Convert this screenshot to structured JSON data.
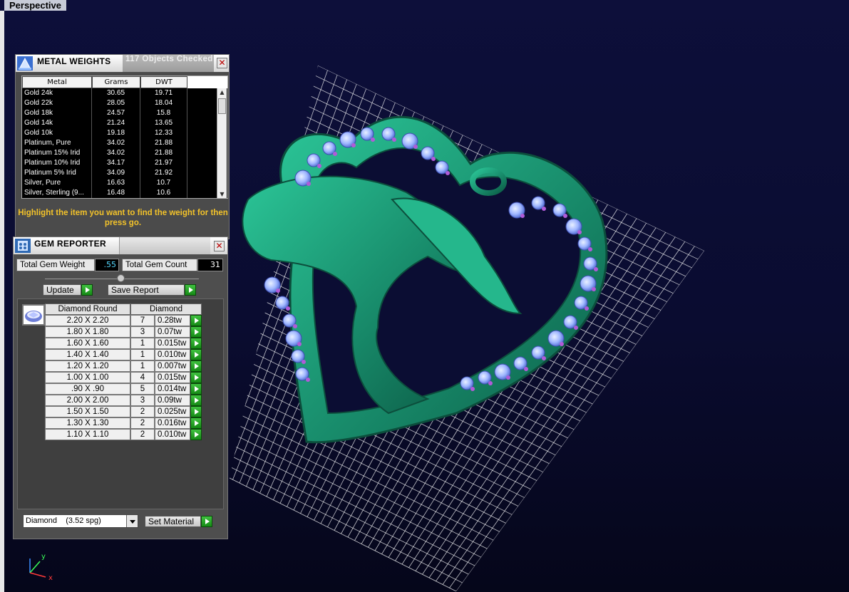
{
  "viewport": {
    "label": "Perspective"
  },
  "metal_weights": {
    "title": "METAL WEIGHTS",
    "objects_checked": "117 Objects Checked",
    "close": "✕",
    "columns": [
      "Metal",
      "Grams",
      "DWT"
    ],
    "rows": [
      [
        "Gold 24k",
        "30.65",
        "19.71"
      ],
      [
        "Gold 22k",
        "28.05",
        "18.04"
      ],
      [
        "Gold 18k",
        "24.57",
        "15.8"
      ],
      [
        "Gold 14k",
        "21.24",
        "13.65"
      ],
      [
        "Gold 10k",
        "19.18",
        "12.33"
      ],
      [
        "Platinum, Pure",
        "34.02",
        "21.88"
      ],
      [
        "Platinum 15% Irid",
        "34.02",
        "21.88"
      ],
      [
        "Platinum 10% Irid",
        "34.17",
        "21.97"
      ],
      [
        "Platinum 5% Irid",
        "34.09",
        "21.92"
      ],
      [
        "Silver, Pure",
        "16.63",
        "10.7"
      ],
      [
        "Silver, Sterling (9...",
        "16.48",
        "10.6"
      ]
    ],
    "hint": "Highlight the item you want to find the weight for then press go."
  },
  "gem_reporter": {
    "title": "GEM REPORTER",
    "close": "✕",
    "total_weight_label": "Total Gem Weight",
    "total_weight_value": ".55",
    "total_count_label": "Total Gem Count",
    "total_count_value": "31",
    "update_label": "Update",
    "save_report_label": "Save Report",
    "table_headers": [
      "Diamond Round",
      "Diamond"
    ],
    "gems": [
      [
        "2.20 X 2.20",
        "7",
        "0.28tw"
      ],
      [
        "1.80 X 1.80",
        "3",
        "0.07tw"
      ],
      [
        "1.60 X 1.60",
        "1",
        "0.015tw"
      ],
      [
        "1.40 X 1.40",
        "1",
        "0.010tw"
      ],
      [
        "1.20 X 1.20",
        "1",
        "0.007tw"
      ],
      [
        "1.00 X 1.00",
        "4",
        "0.015tw"
      ],
      [
        ".90 X .90",
        "5",
        "0.014tw"
      ],
      [
        "2.00 X 2.00",
        "3",
        "0.09tw"
      ],
      [
        "1.50 X 1.50",
        "2",
        "0.025tw"
      ],
      [
        "1.30 X 1.30",
        "2",
        "0.016tw"
      ],
      [
        "1.10 X 1.10",
        "2",
        "0.010tw"
      ]
    ],
    "material_value": "Diamond    (3.52 spg)",
    "set_material_label": "Set Material"
  },
  "axis": {
    "y": "y",
    "x": "x"
  },
  "colors": {
    "model": "#1f9a78",
    "gem": "#a9c2ff",
    "accent_gem": "#b05bd8",
    "grid": "#ffffff"
  }
}
